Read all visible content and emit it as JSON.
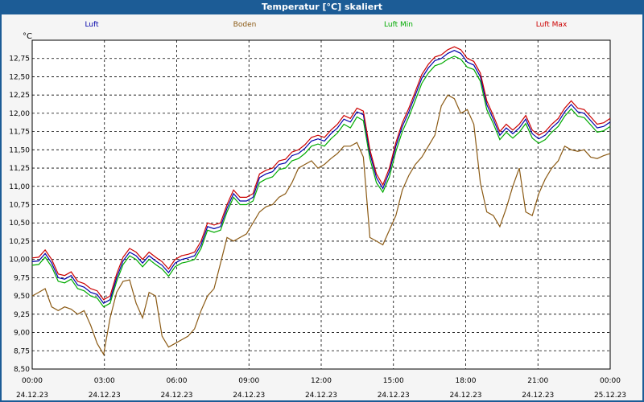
{
  "window": {
    "title": "Temperatur [°C] skaliert"
  },
  "chart_data": {
    "type": "line",
    "title": "Temperatur [°C] skaliert",
    "ylabel": "°C",
    "ylim": [
      8.5,
      13.0
    ],
    "xlim": [
      "2023-12-24 00:00",
      "2023-12-25 00:00"
    ],
    "grid": true,
    "legend_placement": "top",
    "y_ticks": [
      "8,50",
      "8,75",
      "9,00",
      "9,25",
      "9,50",
      "9,75",
      "10,00",
      "10,25",
      "10,50",
      "10,75",
      "11,00",
      "11,25",
      "11,50",
      "11,75",
      "12,00",
      "12,25",
      "12,50",
      "12,75"
    ],
    "x_ticks": [
      {
        "time": "00:00",
        "date": "24.12.23"
      },
      {
        "time": "03:00",
        "date": "24.12.23"
      },
      {
        "time": "06:00",
        "date": "24.12.23"
      },
      {
        "time": "09:00",
        "date": "24.12.23"
      },
      {
        "time": "12:00",
        "date": "24.12.23"
      },
      {
        "time": "15:00",
        "date": "24.12.23"
      },
      {
        "time": "18:00",
        "date": "24.12.23"
      },
      {
        "time": "21:00",
        "date": "24.12.23"
      },
      {
        "time": "00:00",
        "date": "25.12.23"
      }
    ],
    "x_hours": [
      0,
      0.25,
      0.5,
      0.75,
      1,
      1.25,
      1.5,
      1.75,
      2,
      2.25,
      2.5,
      2.75,
      3,
      3.25,
      3.5,
      3.75,
      4,
      4.25,
      4.5,
      4.75,
      5,
      5.25,
      5.5,
      5.75,
      6,
      6.25,
      6.5,
      6.75,
      7,
      7.25,
      7.5,
      7.75,
      8,
      8.25,
      8.5,
      8.75,
      9,
      9.25,
      9.5,
      9.75,
      10,
      10.25,
      10.5,
      10.75,
      11,
      11.25,
      11.5,
      11.75,
      12,
      12.25,
      12.5,
      12.75,
      13,
      13.25,
      13.5,
      13.75,
      14,
      14.25,
      14.5,
      14.75,
      15,
      15.25,
      15.5,
      15.75,
      16,
      16.25,
      16.5,
      16.75,
      17,
      17.25,
      17.5,
      17.75,
      18,
      18.25,
      18.5,
      18.75,
      19,
      19.25,
      19.5,
      19.75,
      20,
      20.25,
      20.5,
      20.75,
      21,
      21.25,
      21.5,
      21.75,
      22,
      22.25,
      22.5,
      22.75,
      23,
      23.25,
      23.5,
      23.75,
      24
    ],
    "series": [
      {
        "name": "Luft",
        "color": "#0000aa",
        "values": [
          9.97,
          9.98,
          10.08,
          9.95,
          9.75,
          9.73,
          9.78,
          9.65,
          9.62,
          9.55,
          9.52,
          9.4,
          9.45,
          9.75,
          9.98,
          10.1,
          10.05,
          9.95,
          10.05,
          9.98,
          9.92,
          9.82,
          9.95,
          10.0,
          10.02,
          10.05,
          10.2,
          10.45,
          10.42,
          10.45,
          10.7,
          10.9,
          10.8,
          10.8,
          10.85,
          11.12,
          11.17,
          11.2,
          11.3,
          11.32,
          11.42,
          11.45,
          11.52,
          11.62,
          11.65,
          11.62,
          11.72,
          11.8,
          11.92,
          11.88,
          12.02,
          11.98,
          11.45,
          11.12,
          10.97,
          11.2,
          11.55,
          11.82,
          12.02,
          12.25,
          12.48,
          12.62,
          12.72,
          12.75,
          12.82,
          12.86,
          12.82,
          12.7,
          12.66,
          12.5,
          12.12,
          11.92,
          11.7,
          11.8,
          11.72,
          11.8,
          11.92,
          11.72,
          11.65,
          11.7,
          11.8,
          11.88,
          12.02,
          12.12,
          12.02,
          12.0,
          11.9,
          11.8,
          11.82,
          11.88
        ],
        "hours_note": ""
      },
      {
        "name": "Boden",
        "color": "#8b5a14",
        "values": [
          9.5,
          9.55,
          9.6,
          9.35,
          9.3,
          9.35,
          9.32,
          9.25,
          9.3,
          9.1,
          8.85,
          8.7,
          9.2,
          9.55,
          9.7,
          9.72,
          9.4,
          9.2,
          9.55,
          9.5,
          8.95,
          8.8,
          8.85,
          8.9,
          8.95,
          9.05,
          9.3,
          9.5,
          9.6,
          9.95,
          10.3,
          10.25,
          10.3,
          10.35,
          10.5,
          10.65,
          10.72,
          10.75,
          10.85,
          10.9,
          11.05,
          11.25,
          11.3,
          11.35,
          11.25,
          11.3,
          11.38,
          11.45,
          11.55,
          11.55,
          11.6,
          11.4,
          10.3,
          10.25,
          10.2,
          10.4,
          10.6,
          10.95,
          11.15,
          11.3,
          11.4,
          11.55,
          11.7,
          12.1,
          12.25,
          12.2,
          12.0,
          12.05,
          11.85,
          11.05,
          10.65,
          10.6,
          10.45,
          10.7,
          11.0,
          11.25,
          10.65,
          10.6,
          10.9,
          11.1,
          11.25,
          11.35,
          11.55,
          11.5,
          11.48,
          11.5,
          11.4,
          11.38,
          11.42,
          11.45
        ],
        "hours_note": ""
      },
      {
        "name": "Luft Min",
        "color": "#00aa00",
        "values": [
          9.92,
          9.93,
          10.03,
          9.9,
          9.7,
          9.68,
          9.73,
          9.6,
          9.57,
          9.5,
          9.47,
          9.35,
          9.4,
          9.7,
          9.93,
          10.05,
          10.0,
          9.9,
          10.0,
          9.93,
          9.87,
          9.77,
          9.9,
          9.95,
          9.97,
          10.0,
          10.15,
          10.4,
          10.37,
          10.4,
          10.65,
          10.85,
          10.75,
          10.75,
          10.8,
          11.05,
          11.1,
          11.13,
          11.23,
          11.25,
          11.35,
          11.38,
          11.45,
          11.55,
          11.58,
          11.55,
          11.65,
          11.73,
          11.85,
          11.8,
          11.95,
          11.9,
          11.38,
          11.05,
          10.92,
          11.13,
          11.48,
          11.75,
          11.95,
          12.18,
          12.41,
          12.55,
          12.65,
          12.68,
          12.74,
          12.78,
          12.74,
          12.63,
          12.6,
          12.44,
          12.05,
          11.86,
          11.64,
          11.74,
          11.66,
          11.74,
          11.86,
          11.66,
          11.59,
          11.64,
          11.74,
          11.82,
          11.96,
          12.06,
          11.96,
          11.94,
          11.84,
          11.74,
          11.76,
          11.82
        ],
        "hours_note": ""
      },
      {
        "name": "Luft Max",
        "color": "#cc0000",
        "values": [
          10.02,
          10.03,
          10.13,
          10.0,
          9.8,
          9.78,
          9.83,
          9.7,
          9.67,
          9.6,
          9.57,
          9.45,
          9.5,
          9.8,
          10.03,
          10.15,
          10.1,
          10.0,
          10.1,
          10.03,
          9.97,
          9.87,
          10.0,
          10.05,
          10.07,
          10.1,
          10.25,
          10.5,
          10.47,
          10.5,
          10.75,
          10.95,
          10.85,
          10.85,
          10.9,
          11.17,
          11.22,
          11.25,
          11.35,
          11.37,
          11.47,
          11.5,
          11.57,
          11.67,
          11.7,
          11.67,
          11.77,
          11.85,
          11.97,
          11.93,
          12.07,
          12.03,
          11.5,
          11.17,
          11.02,
          11.25,
          11.6,
          11.87,
          12.07,
          12.3,
          12.53,
          12.67,
          12.77,
          12.8,
          12.87,
          12.91,
          12.87,
          12.75,
          12.71,
          12.55,
          12.17,
          11.97,
          11.75,
          11.85,
          11.77,
          11.85,
          11.97,
          11.77,
          11.7,
          11.75,
          11.85,
          11.93,
          12.07,
          12.17,
          12.07,
          12.05,
          11.95,
          11.85,
          11.87,
          11.93
        ],
        "hours_note": ""
      }
    ]
  }
}
